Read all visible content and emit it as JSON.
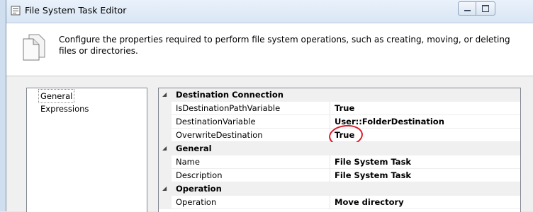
{
  "window": {
    "title": "File System Task Editor",
    "controls": [
      "minimize",
      "maximize"
    ]
  },
  "header": {
    "description": "Configure the properties required to perform file system operations, such as creating, moving, or deleting files or directories.",
    "icon": "document-icon"
  },
  "nav": {
    "items": [
      {
        "label": "General",
        "selected": true
      },
      {
        "label": "Expressions",
        "selected": false
      }
    ]
  },
  "grid": {
    "categories": [
      {
        "label": "Destination Connection",
        "properties": [
          {
            "name": "IsDestinationPathVariable",
            "value": "True"
          },
          {
            "name": "DestinationVariable",
            "value": "User::FolderDestination"
          },
          {
            "name": "OverwriteDestination",
            "value": "True",
            "annotated": true
          }
        ]
      },
      {
        "label": "General",
        "properties": [
          {
            "name": "Name",
            "value": "File System Task"
          },
          {
            "name": "Description",
            "value": "File System Task"
          }
        ]
      },
      {
        "label": "Operation",
        "properties": [
          {
            "name": "Operation",
            "value": "Move directory"
          }
        ]
      }
    ]
  },
  "colors": {
    "annotation": "#d91c2a",
    "category_bg": "#f0f0f0",
    "titlebar": "#dae6f4"
  }
}
